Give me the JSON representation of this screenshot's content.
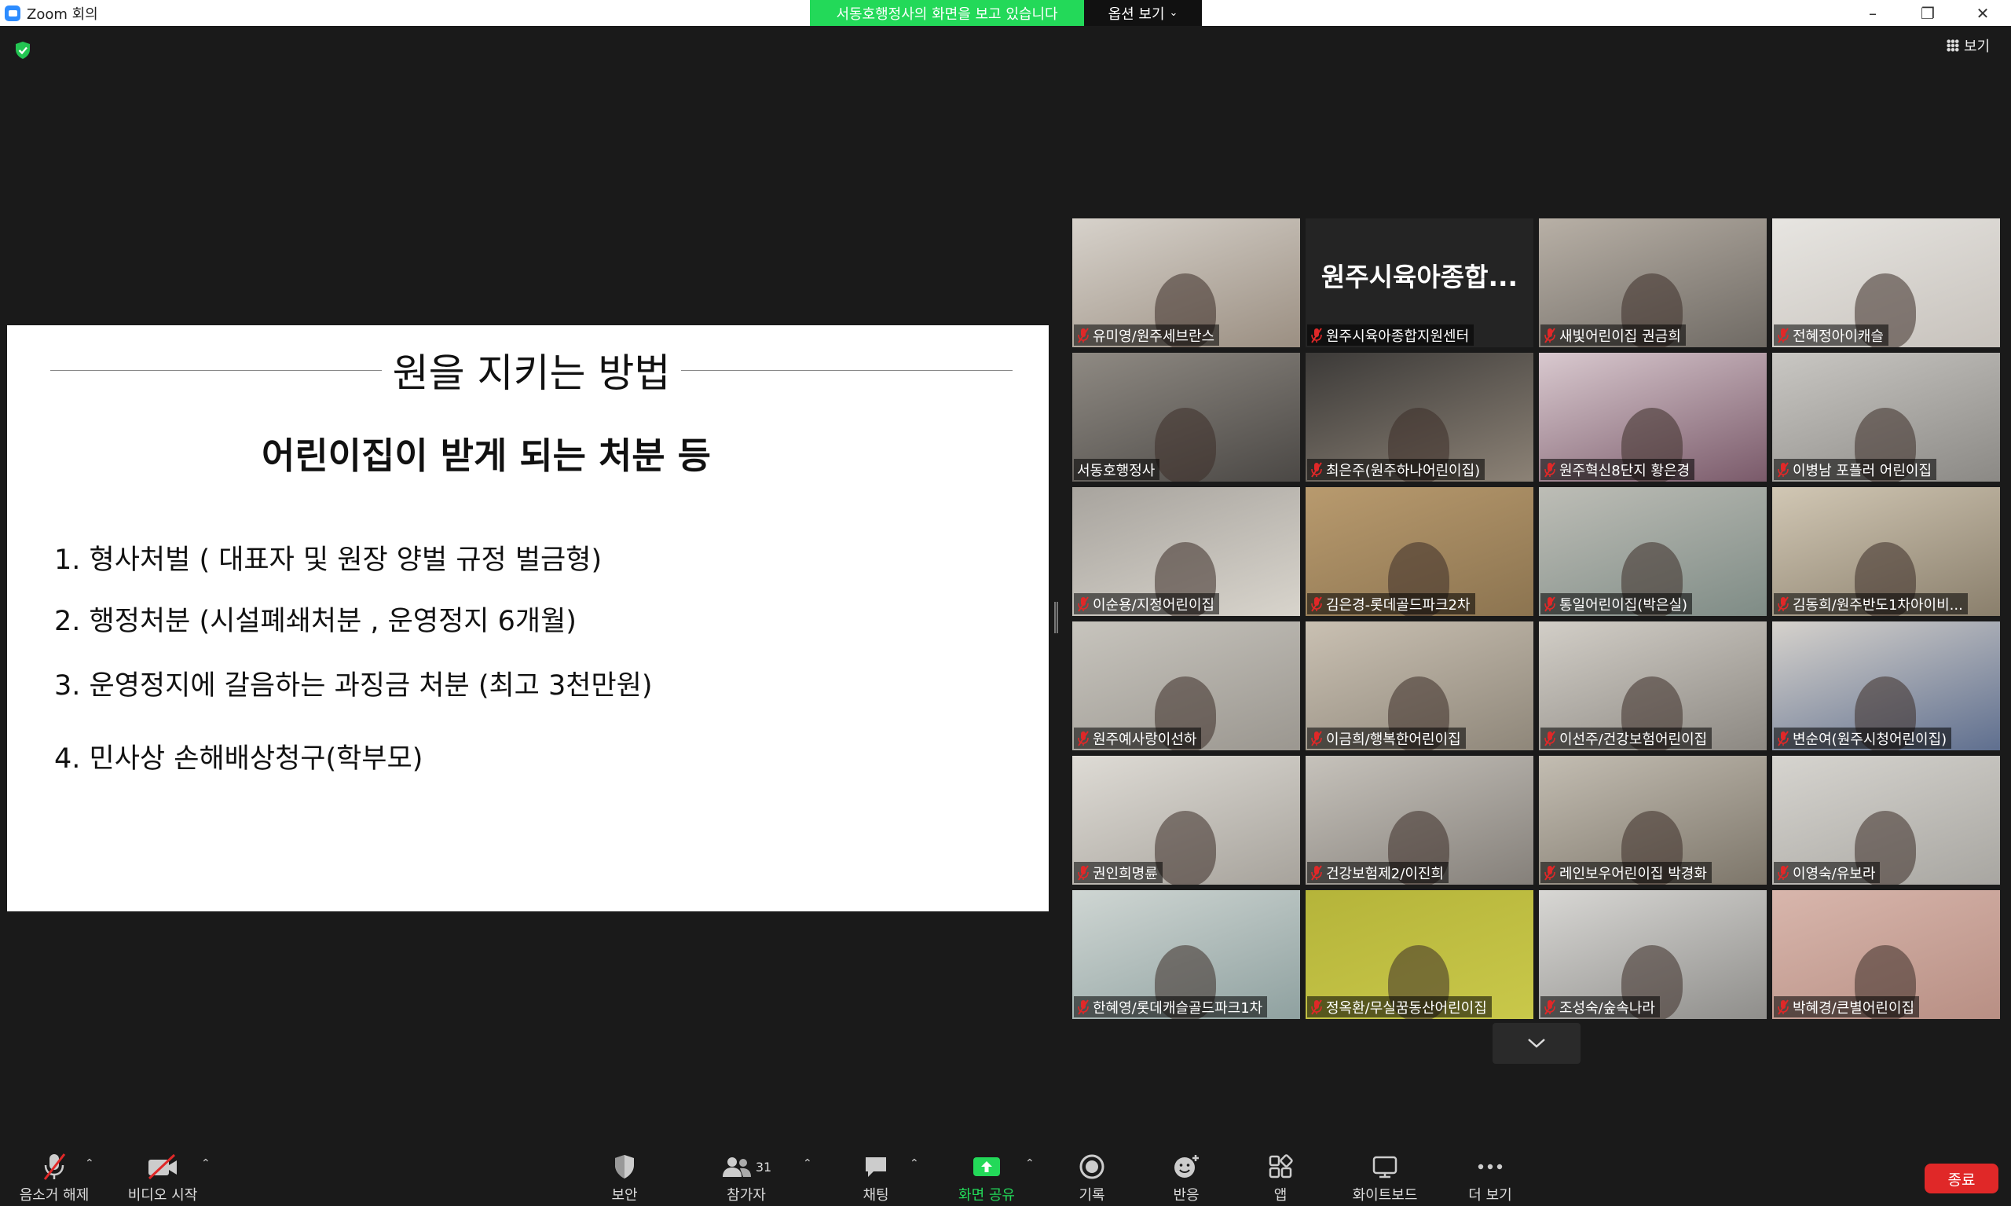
{
  "window": {
    "title": "Zoom 회의",
    "share_banner": "서동호행정사의 화면을 보고 있습니다",
    "view_options": "옵션 보기",
    "view_button": "보기"
  },
  "slide": {
    "title": "원을 지키는 방법",
    "subtitle": "어린이집이 받게 되는 처분 등",
    "items": [
      "1.  형사처벌 ( 대표자 및 원장 양벌 규정 벌금형)",
      "2.  행정처분 (시설폐쇄처분 , 운영정지 6개월)",
      "3.  운영정지에 갈음하는 과징금 처분 (최고 3천만원)",
      "4.  민사상 손해배상청구(학부모)"
    ]
  },
  "gallery": {
    "tiles": [
      {
        "name": "유미영/원주세브란스",
        "muted": true
      },
      {
        "name": "원주시육아종합지원센터",
        "muted": true,
        "big": "원주시육아종합..."
      },
      {
        "name": "새빛어린이집 권금희",
        "muted": true
      },
      {
        "name": "전혜정아이캐슬",
        "muted": true
      },
      {
        "name": "서동호행정사",
        "muted": false,
        "active": true
      },
      {
        "name": "최은주(원주하나어린이집)",
        "muted": true
      },
      {
        "name": "원주혁신8단지 황은경",
        "muted": true
      },
      {
        "name": "이병남 포플러 어린이집",
        "muted": true
      },
      {
        "name": "이순용/지정어린이집",
        "muted": true
      },
      {
        "name": "김은경-롯데골드파크2차",
        "muted": true
      },
      {
        "name": "통일어린이집(박은실)",
        "muted": true
      },
      {
        "name": "김동희/원주반도1차아이비...",
        "muted": true
      },
      {
        "name": "원주예사랑이선하",
        "muted": true
      },
      {
        "name": "이금희/행복한어린이집",
        "muted": true
      },
      {
        "name": "이선주/건강보험어린이집",
        "muted": true
      },
      {
        "name": "변순여(원주시청어린이집)",
        "muted": true
      },
      {
        "name": "권인희명륜",
        "muted": true
      },
      {
        "name": "건강보험제2/이진희",
        "muted": true
      },
      {
        "name": "레인보우어린이집 박경화",
        "muted": true
      },
      {
        "name": "이영숙/유보라",
        "muted": true
      },
      {
        "name": "한혜영/롯데캐슬골드파크1차",
        "muted": true
      },
      {
        "name": "정옥환/무실꿈동산어린이집",
        "muted": true
      },
      {
        "name": "조성숙/숲속나라",
        "muted": true
      },
      {
        "name": "박혜경/큰별어린이집",
        "muted": true
      }
    ]
  },
  "toolbar": {
    "unmute": "음소거 해제",
    "start_video": "비디오 시작",
    "security": "보안",
    "participants": "참가자",
    "participant_count": "31",
    "chat": "채팅",
    "share_screen": "화면 공유",
    "record": "기록",
    "reactions": "반응",
    "apps": "앱",
    "whiteboard": "화이트보드",
    "more": "더 보기",
    "end": "종료"
  },
  "colors": {
    "share_banner": "#23d959",
    "active_speaker": "#d4ff3d",
    "end_button": "#e02828",
    "share_icon": "#23d959",
    "mute_slash": "#e02828"
  }
}
